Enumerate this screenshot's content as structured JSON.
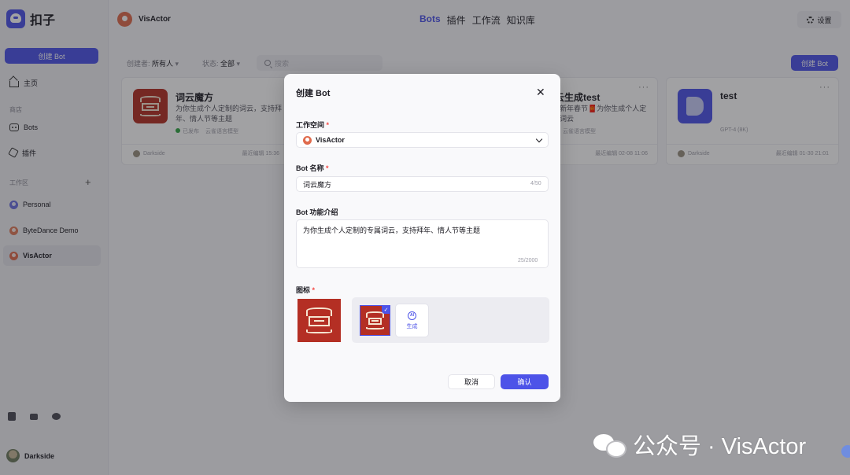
{
  "app": {
    "brand_name": "扣子",
    "create_bot": "创建 Bot"
  },
  "sidebar": {
    "nav": [
      {
        "label": "主页",
        "icon": "home-icon"
      },
      {
        "label": "Bots",
        "icon": "bots-icon"
      },
      {
        "label": "插件",
        "icon": "plugin-icon"
      }
    ],
    "store_label": "商店",
    "workspace_label": "工作区",
    "workspaces": [
      {
        "label": "Personal",
        "color": "#6a6fe0"
      },
      {
        "label": "ByteDance Demo",
        "color": "#e07a5a"
      },
      {
        "label": "VisActor",
        "color": "#e06b4d",
        "active": true
      }
    ],
    "user": "Darkside"
  },
  "header": {
    "space": "VisActor",
    "tabs": [
      "Bots",
      "插件",
      "工作流",
      "知识库"
    ],
    "active_tab": "Bots",
    "settings": "设置"
  },
  "filters": {
    "creator_label": "创建者:",
    "creator_value": "所有人",
    "status_label": "状态:",
    "status_value": "全部",
    "search_placeholder": "搜索",
    "create_button": "创建 Bot"
  },
  "cards": [
    {
      "title": "词云魔方",
      "desc": "为你生成个人定制的词云，支持拜年、情人节等主题",
      "status": "已发布",
      "model": "云雀语言模型",
      "author": "Darkside",
      "time": "最近编辑 15:36"
    },
    {
      "title": "词云生成test",
      "desc": "生成新年春节🧧为你生成个人定制的词云",
      "model": "云雀语言模型",
      "time": "最近编辑 02-08 11:06"
    },
    {
      "title": "test",
      "model": "GPT-4 (8K)",
      "author": "Darkside",
      "time": "最近编辑 01-30 21:01"
    }
  ],
  "modal": {
    "title": "创建 Bot",
    "workspace_label": "工作空间",
    "workspace_value": "VisActor",
    "name_label": "Bot 名称",
    "name_value": "词云魔方",
    "name_counter": "4/50",
    "desc_label": "Bot 功能介绍",
    "desc_value": "为你生成个人定制的专属词云，支持拜年、情人节等主题",
    "desc_counter": "25/2000",
    "icon_label": "图标",
    "generate_label": "生成",
    "cancel": "取消",
    "confirm": "确认",
    "required_mark": "*"
  },
  "watermark": {
    "text": "公众号 · VisActor"
  },
  "colors": {
    "accent": "#4d53e8",
    "icon_red": "#b42f24",
    "overlay": "rgba(30,30,36,0.42)"
  }
}
